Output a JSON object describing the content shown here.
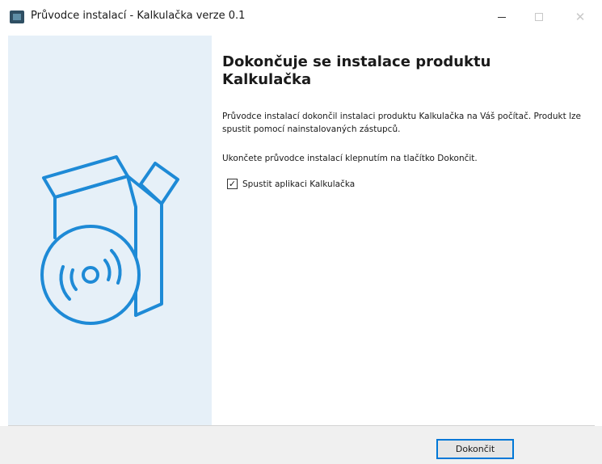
{
  "window": {
    "title": "Průvodce instalací - Kalkulačka verze 0.1",
    "controls": {
      "minimize_icon": "minimize-icon",
      "maximize_icon": "maximize-icon",
      "close_icon": "close-icon",
      "close_glyph": "✕"
    }
  },
  "sidebar": {
    "graphic_icon": "box-disc-icon",
    "background_color": "#e6f0f8",
    "graphic_color": "#1e8ad6"
  },
  "content": {
    "heading": "Dokončuje se instalace produktu Kalkulačka",
    "description": "Průvodce instalací dokončil instalaci produktu Kalkulačka na Váš počítač. Produkt lze spustit pomocí nainstalovaných zástupců.",
    "finish_hint": "Ukončete průvodce instalací klepnutím na tlačítko Dokončit.",
    "launch_checkbox": {
      "label": "Spustit aplikaci Kalkulačka",
      "checked": true,
      "check_glyph": "✓"
    }
  },
  "footer": {
    "finish_button_label": "Dokončit",
    "accent_color": "#0078d7"
  }
}
